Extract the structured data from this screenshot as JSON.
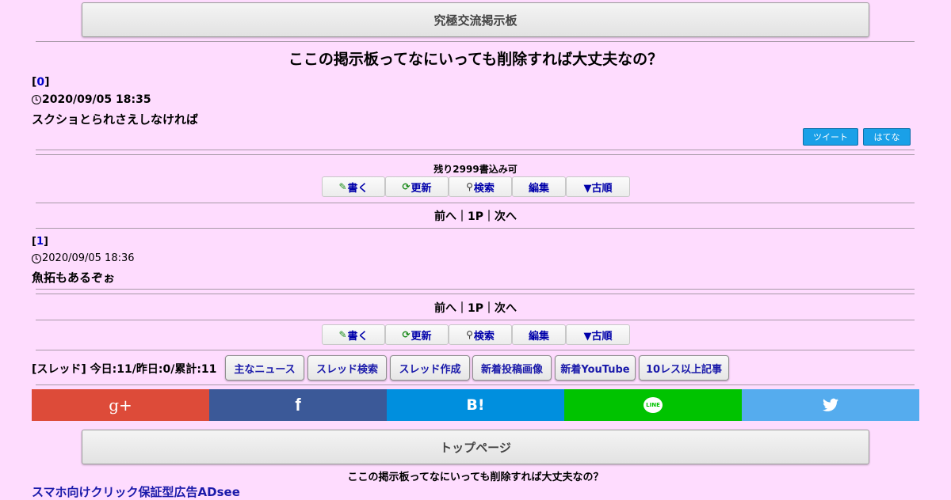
{
  "header": {
    "board_button": "究極交流掲示板"
  },
  "thread": {
    "title": "ここの掲示板ってなにいっても削除すれば大丈夫なの？"
  },
  "posts": [
    {
      "num_open": "[",
      "num": "0",
      "num_close": "]",
      "date": "2020/09/05 18:35",
      "body": "スクショとられさえしなければ"
    },
    {
      "num_open": "[",
      "num": "1",
      "num_close": "]",
      "date": "2020/09/05 18:36",
      "body": "魚拓もあるぞぉ"
    }
  ],
  "share_small": {
    "tweet": "ツイート",
    "hatena": "はてな"
  },
  "remaining": "残り2999書込み可",
  "toolbar": {
    "write": "書く",
    "refresh": "更新",
    "search": "検索",
    "edit": "編集",
    "order": "▼古順"
  },
  "pager": {
    "prev": "前へ",
    "sep1": "｜",
    "page": "1P",
    "sep2": "｜",
    "next": "次へ"
  },
  "stats": "[スレッド] 今日:11/昨日:0/累計:11",
  "nav": [
    "主なニュース",
    "スレッド検索",
    "スレッド作成",
    "新着投稿画像",
    "新着YouTube",
    "10レス以上記事"
  ],
  "social": {
    "gplus": "g+",
    "facebook": "f",
    "hatena": "B!",
    "line": "LINE",
    "twitter": "t"
  },
  "colors": {
    "gplus": "#dd4b39",
    "facebook": "#3b5998",
    "hatena": "#008fde",
    "line": "#00c300",
    "twitter": "#55acee"
  },
  "footer": {
    "top_button": "トップページ",
    "thread_title": "ここの掲示板ってなにいっても削除すれば大丈夫なの？",
    "ad_link": "スマホ向けクリック保証型広告ADsee"
  }
}
